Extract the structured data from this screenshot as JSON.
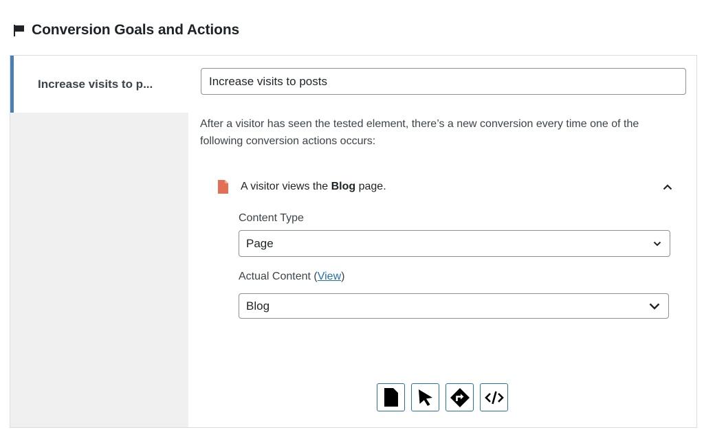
{
  "header": {
    "title": "Conversion Goals and Actions",
    "icon": "flag-icon"
  },
  "sidebar": {
    "active_goal_label": "Increase visits to p..."
  },
  "goal": {
    "name_value": "Increase visits to posts",
    "description": "After a visitor has seen the tested element, there’s a new conversion every time one of the following conversion actions occurs:"
  },
  "action": {
    "text_prefix": "A visitor views the ",
    "text_bold": "Blog",
    "text_suffix": " page.",
    "icon": "page-icon",
    "icon_color": "#e26f56"
  },
  "content_type": {
    "label": "Content Type",
    "selected": "Page"
  },
  "actual_content": {
    "label_prefix": "Actual Content (",
    "link": "View",
    "label_suffix": ")",
    "selected": "Blog"
  },
  "toolbar": {
    "buttons": [
      "page-icon",
      "cursor-icon",
      "direction-icon",
      "code-icon"
    ]
  },
  "colors": {
    "accent": "#2271b1",
    "tab_border": "#4a7fb5",
    "sidebar_bg": "#f0f0f1"
  }
}
